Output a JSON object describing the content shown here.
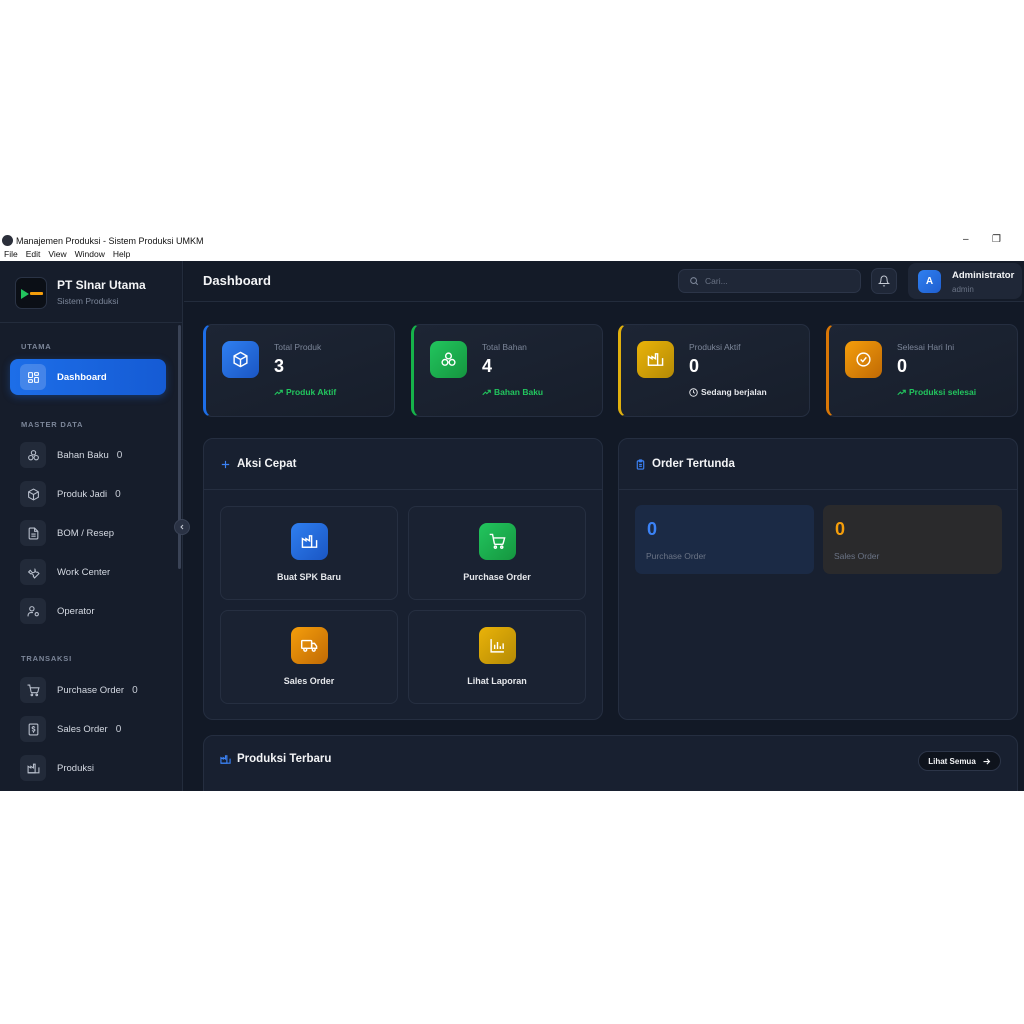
{
  "window": {
    "title": "Manajemen Produksi - Sistem Produksi UMKM",
    "menu": [
      "File",
      "Edit",
      "View",
      "Window",
      "Help"
    ],
    "controls": {
      "minimize": "–",
      "restore": "❐"
    }
  },
  "brand": {
    "name": "PT SInar Utama",
    "subtitle": "Sistem Produksi"
  },
  "sidebar": {
    "sections": [
      {
        "label": "UTAMA"
      },
      {
        "label": "MASTER DATA"
      },
      {
        "label": "TRANSAKSI"
      }
    ],
    "items": [
      {
        "label": "Dashboard",
        "icon": "dashboard-icon",
        "count": "",
        "active": true
      },
      {
        "label": "Bahan Baku",
        "icon": "boxes-icon",
        "count": "0"
      },
      {
        "label": "Produk Jadi",
        "icon": "package-icon",
        "count": "0"
      },
      {
        "label": "BOM / Resep",
        "icon": "document-icon",
        "count": ""
      },
      {
        "label": "Work Center",
        "icon": "wrench-icon",
        "count": ""
      },
      {
        "label": "Operator",
        "icon": "user-gear-icon",
        "count": ""
      },
      {
        "label": "Purchase Order",
        "icon": "cart-icon",
        "count": "0"
      },
      {
        "label": "Sales Order",
        "icon": "dollar-receipt-icon",
        "count": "0"
      },
      {
        "label": "Produksi",
        "icon": "factory-icon",
        "count": ""
      }
    ]
  },
  "header": {
    "title": "Dashboard",
    "search_placeholder": "Cari...",
    "user": {
      "initial": "A",
      "name": "Administrator",
      "role": "admin"
    }
  },
  "stats": [
    {
      "label": "Total Produk",
      "value": "3",
      "footer": "Produk Aktif",
      "color": "#1d6ee8",
      "footer_color": "#22c55e"
    },
    {
      "label": "Total Bahan",
      "value": "4",
      "footer": "Bahan Baku",
      "color": "#16b34a",
      "footer_color": "#22c55e"
    },
    {
      "label": "Produksi Aktif",
      "value": "0",
      "footer": "Sedang berjalan",
      "color": "#e0b00e",
      "footer_color": "#e5e7eb"
    },
    {
      "label": "Selesai Hari Ini",
      "value": "0",
      "footer": "Produksi selesai",
      "color": "#d97706",
      "footer_color": "#22c55e"
    }
  ],
  "quick_actions": {
    "title": "Aksi Cepat",
    "items": [
      {
        "label": "Buat SPK Baru",
        "icon": "factory-icon",
        "color": "#1d6ee8"
      },
      {
        "label": "Purchase Order",
        "icon": "cart-icon",
        "color": "#16b34a"
      },
      {
        "label": "Sales Order",
        "icon": "truck-icon",
        "color": "#d97706"
      },
      {
        "label": "Lihat Laporan",
        "icon": "bar-chart-icon",
        "color": "#e0b00e"
      }
    ]
  },
  "pending_orders": {
    "title": "Order Tertunda",
    "items": [
      {
        "value": "0",
        "label": "Purchase Order",
        "color": "#3b82f6"
      },
      {
        "value": "0",
        "label": "Sales Order",
        "color": "#f59e0b"
      }
    ]
  },
  "recent_production": {
    "title": "Produksi Terbaru",
    "view_all": "Lihat Semua"
  }
}
